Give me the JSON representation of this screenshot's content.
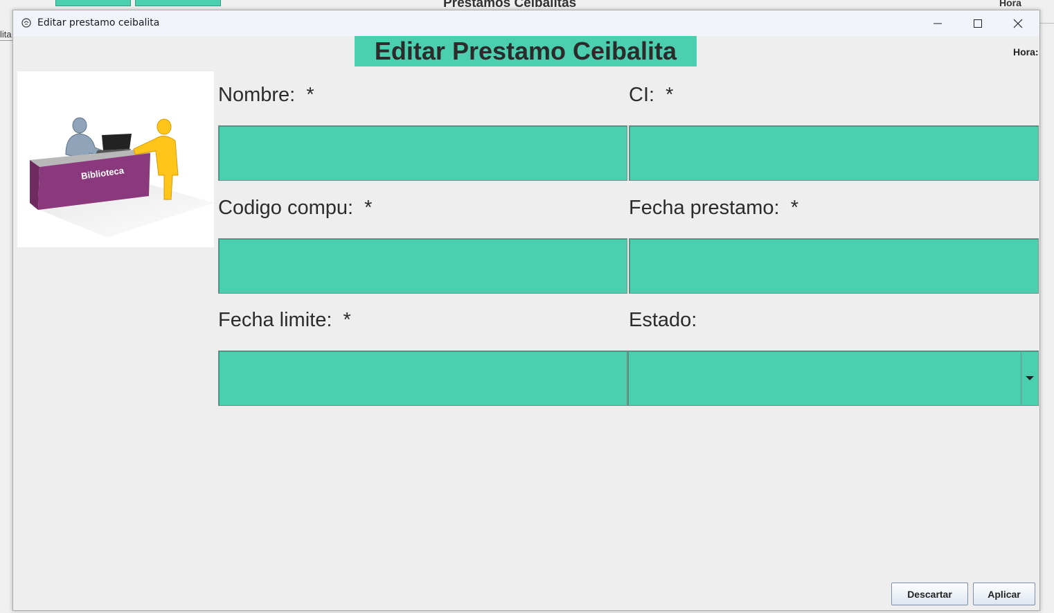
{
  "background": {
    "title": "Prestamos Ceibalitas",
    "hora_label": "Hora",
    "left_fragment": "lita"
  },
  "dialog": {
    "window_title": "Editar prestamo ceibalita",
    "heading": "Editar Prestamo Ceibalita",
    "hora_label": "Hora:",
    "image_label": "Biblioteca",
    "fields": {
      "nombre": {
        "label": "Nombre:  *",
        "value": ""
      },
      "ci": {
        "label": "CI:  *",
        "value": ""
      },
      "codigo": {
        "label": "Codigo compu:  *",
        "value": ""
      },
      "fecha_prestamo": {
        "label": "Fecha prestamo:  *",
        "value": ""
      },
      "fecha_limite": {
        "label": "Fecha limite:  *",
        "value": ""
      },
      "estado": {
        "label": "Estado:",
        "value": ""
      }
    },
    "buttons": {
      "descartar": "Descartar",
      "aplicar": "Aplicar"
    }
  },
  "colors": {
    "accent": "#4bcfae",
    "background": "#eeeeee"
  },
  "icons": [
    "java-app-icon",
    "minimize-icon",
    "maximize-icon",
    "close-icon",
    "chevron-down-icon"
  ]
}
